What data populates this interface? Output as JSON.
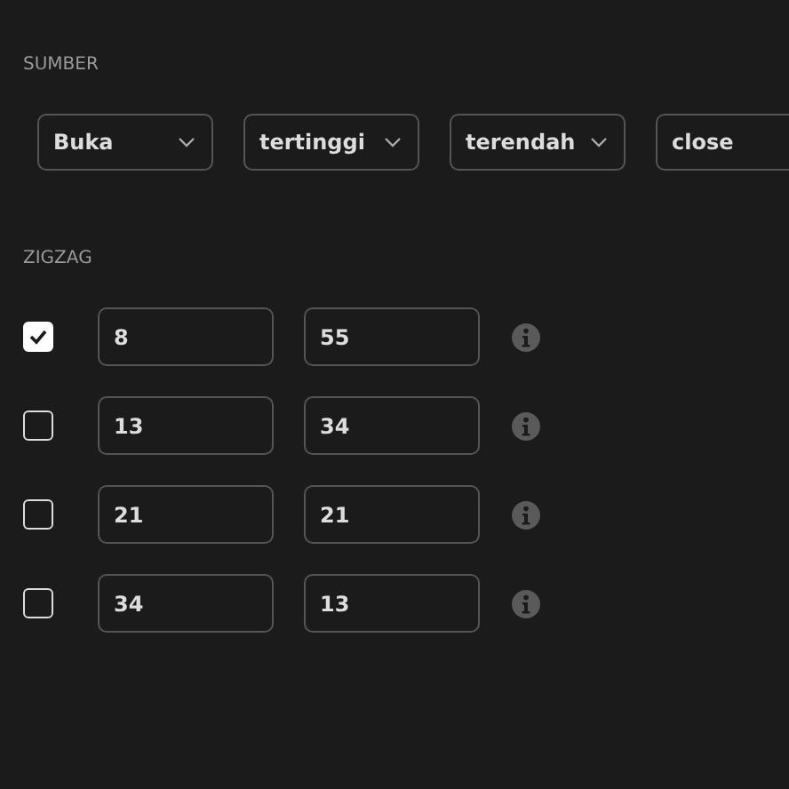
{
  "sumber": {
    "title": "SUMBER",
    "selects": [
      {
        "value": "Buka"
      },
      {
        "value": "tertinggi"
      },
      {
        "value": "terendah"
      },
      {
        "value": "close"
      }
    ]
  },
  "zigzag": {
    "title": "ZIGZAG",
    "rows": [
      {
        "checked": true,
        "deviation": "8",
        "depth": "55"
      },
      {
        "checked": false,
        "deviation": "13",
        "depth": "34"
      },
      {
        "checked": false,
        "deviation": "21",
        "depth": "21"
      },
      {
        "checked": false,
        "deviation": "34",
        "depth": "13"
      }
    ]
  }
}
